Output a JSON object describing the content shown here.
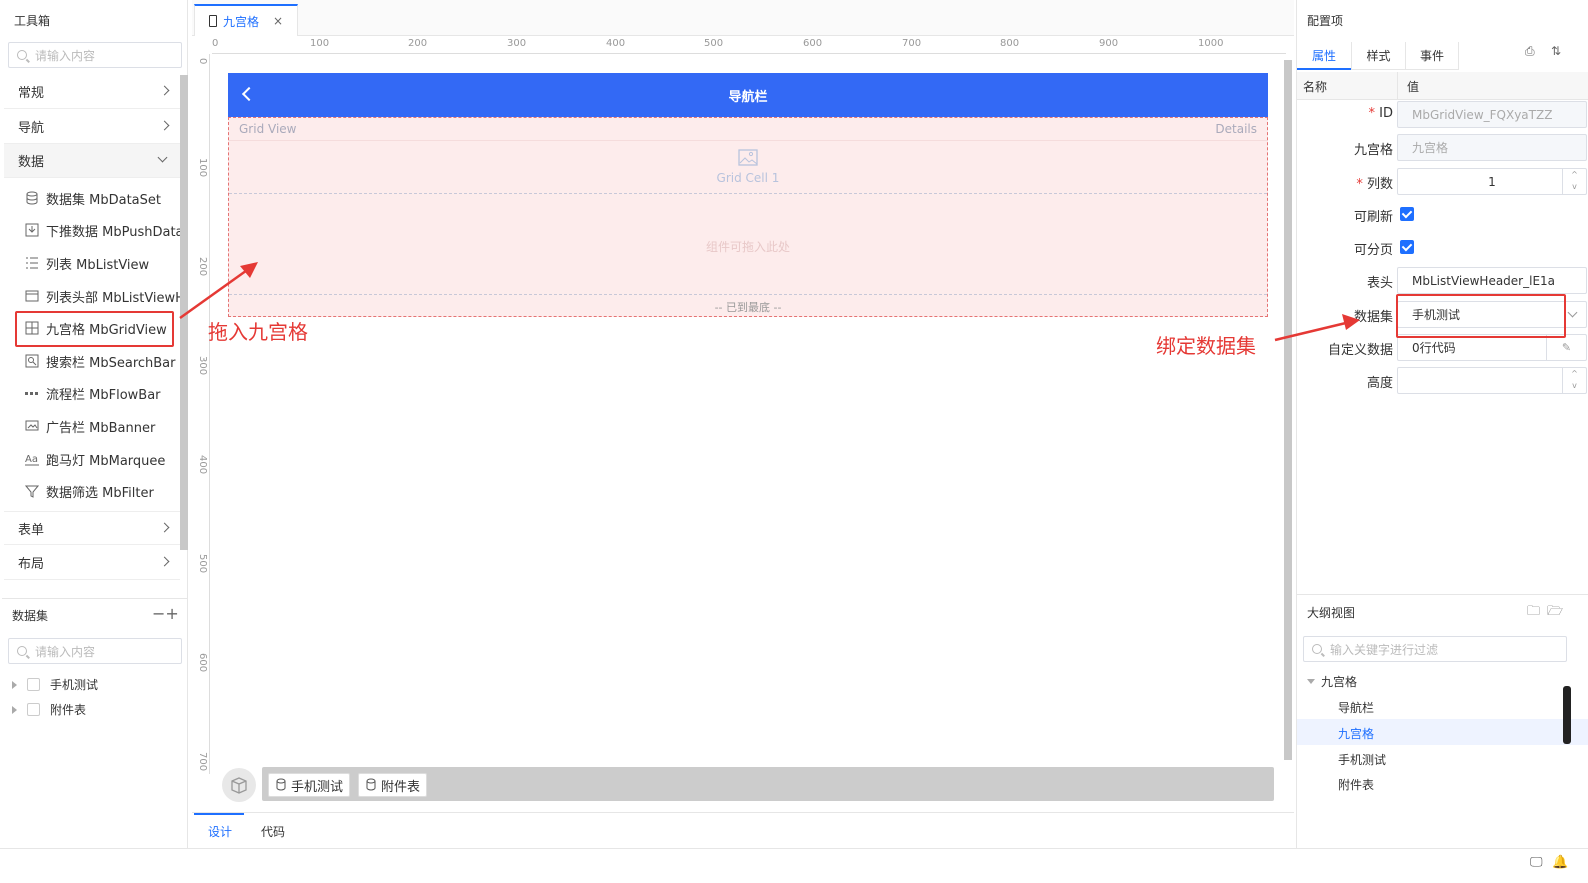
{
  "toolbox": {
    "title": "工具箱",
    "search_placeholder": "请输入内容",
    "categories": [
      "常规",
      "导航",
      "数据",
      "表单",
      "布局"
    ],
    "components": [
      {
        "label": "数据集 MbDataSet",
        "icon": "database-icon"
      },
      {
        "label": "下推数据 MbPushData",
        "icon": "download-icon"
      },
      {
        "label": "列表 MbListView",
        "icon": "list-icon"
      },
      {
        "label": "列表头部 MbListViewH",
        "icon": "header-icon"
      },
      {
        "label": "九宫格 MbGridView",
        "icon": "grid-icon"
      },
      {
        "label": "搜索栏 MbSearchBar",
        "icon": "search-box-icon"
      },
      {
        "label": "流程栏 MbFlowBar",
        "icon": "dots-icon"
      },
      {
        "label": "广告栏 MbBanner",
        "icon": "banner-icon"
      },
      {
        "label": "跑马灯 MbMarquee",
        "icon": "text-aa-icon"
      },
      {
        "label": "数据筛选 MbFilter",
        "icon": "filter-icon"
      }
    ]
  },
  "dataset_panel": {
    "title": "数据集",
    "search_placeholder": "请输入内容",
    "items": [
      "手机测试",
      "附件表"
    ]
  },
  "editor": {
    "tab_label": "九宫格",
    "ruler_h": [
      "0",
      "100",
      "200",
      "300",
      "400",
      "500",
      "600",
      "700",
      "800",
      "900",
      "1000"
    ],
    "ruler_v": [
      "0",
      "100",
      "200",
      "300",
      "400",
      "500",
      "600",
      "700"
    ],
    "navbar_title": "导航栏",
    "grid_header": "Grid View",
    "grid_details": "Details",
    "grid_cell": "Grid Cell 1",
    "drop_hint": "组件可拖入此处",
    "end_text": "-- 已到最底 --",
    "datasets": [
      "手机测试",
      "附件表"
    ],
    "bottom_tabs": [
      "设计",
      "代码"
    ]
  },
  "config": {
    "title": "配置项",
    "tabs": [
      "属性",
      "样式",
      "事件"
    ],
    "header_name": "名称",
    "header_value": "值",
    "rows": {
      "id_label": "ID",
      "id_value": "MbGridView_FQXyaTZZ",
      "name_label": "九宫格",
      "name_value": "九宫格",
      "cols_label": "列数",
      "cols_value": "1",
      "refresh_label": "可刷新",
      "paging_label": "可分页",
      "header_label": "表头",
      "header_value": "MbListViewHeader_lE1a",
      "dataset_label": "数据集",
      "dataset_value": "手机测试",
      "custom_label": "自定义数据",
      "custom_value": "0行代码",
      "height_label": "高度"
    }
  },
  "outline": {
    "title": "大纲视图",
    "search_placeholder": "输入关键字进行过滤",
    "root": "九宫格",
    "children": [
      "导航栏",
      "九宫格",
      "手机测试",
      "附件表"
    ]
  },
  "annotations": {
    "drag_text": "拖入九宫格",
    "bind_text": "绑定数据集",
    "color": "#e53935"
  },
  "colors": {
    "accent": "#1e6fff",
    "navbar": "#3369f5"
  }
}
